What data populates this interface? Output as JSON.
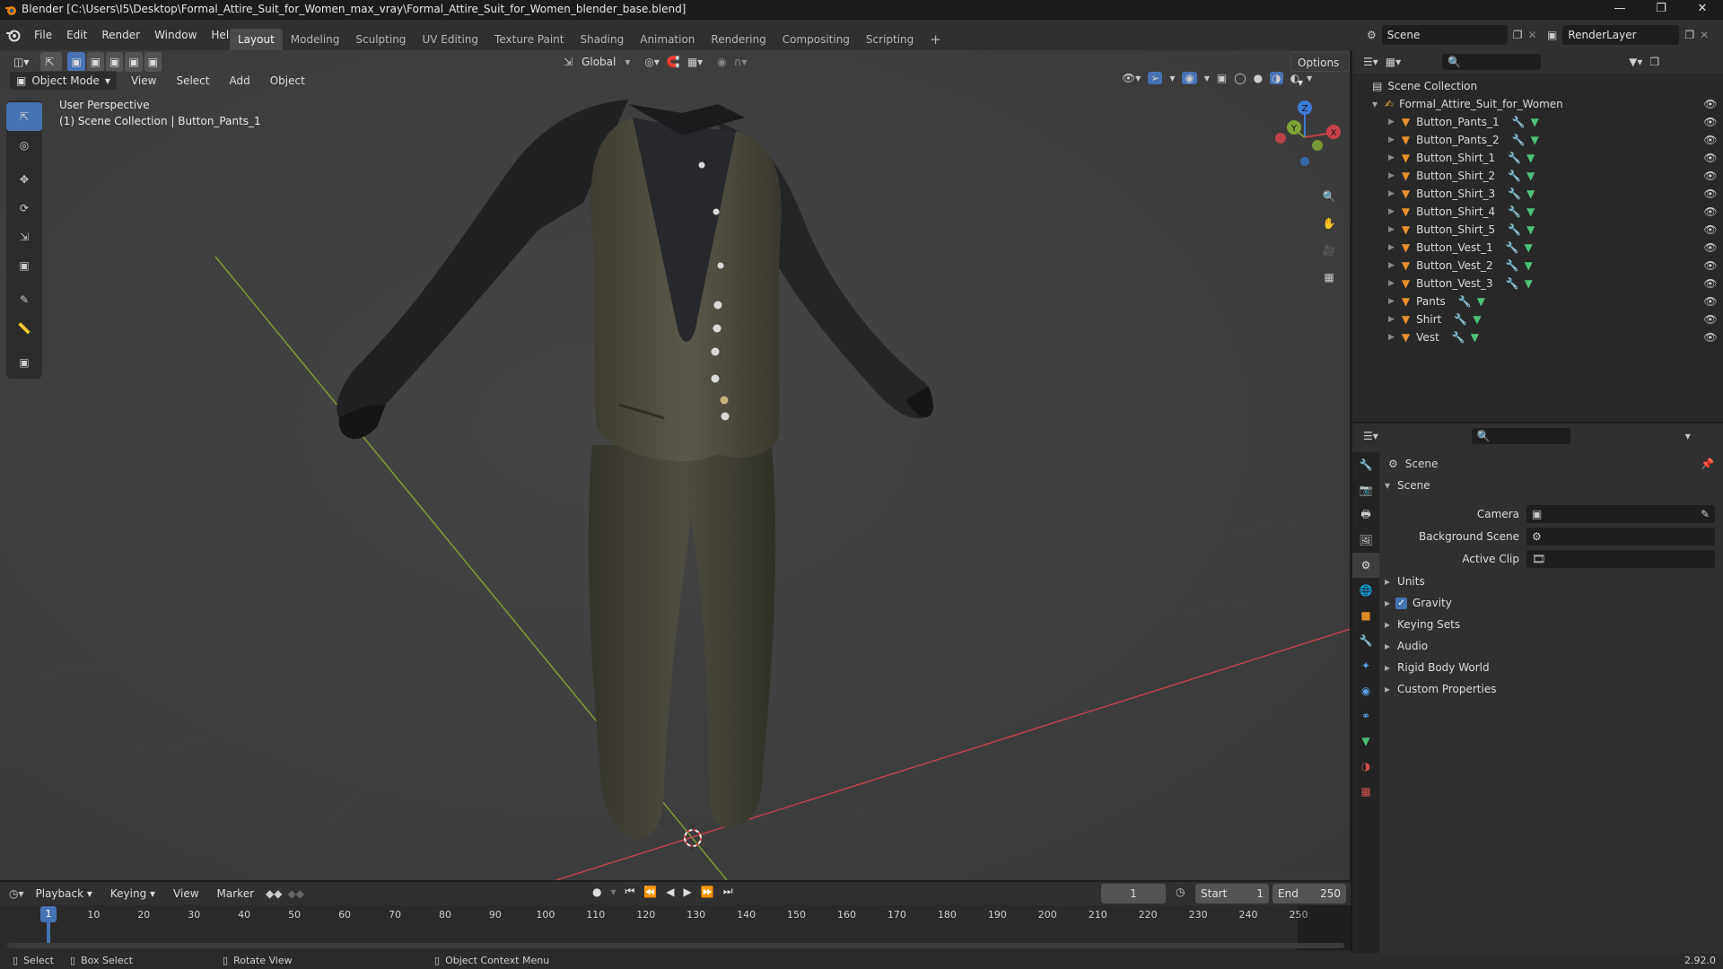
{
  "window": {
    "title": "Blender [C:\\Users\\I5\\Desktop\\Formal_Attire_Suit_for_Women_max_vray\\Formal_Attire_Suit_for_Women_blender_base.blend]",
    "controls": [
      "minimize-icon",
      "maximize-icon",
      "close-icon"
    ]
  },
  "menubar": {
    "menus": [
      "File",
      "Edit",
      "Render",
      "Window",
      "Help"
    ],
    "workspaces": [
      "Layout",
      "Modeling",
      "Sculpting",
      "UV Editing",
      "Texture Paint",
      "Shading",
      "Animation",
      "Rendering",
      "Compositing",
      "Scripting"
    ],
    "active_workspace": "Layout",
    "add_workspace": "+",
    "scene_label": "Scene",
    "renderlayer_label": "RenderLayer"
  },
  "tool_header": {
    "orientation": "Global",
    "options": "Options"
  },
  "viewport": {
    "mode": "Object Mode",
    "menus": [
      "View",
      "Select",
      "Add",
      "Object"
    ],
    "overlay_line1": "User Perspective",
    "overlay_line2": "(1) Scene Collection | Button_Pants_1",
    "gizmo": {
      "x": "X",
      "y": "Y",
      "z": "Z"
    },
    "tools": [
      "select-box-icon",
      "cursor-icon",
      "move-icon",
      "rotate-icon",
      "scale-icon",
      "transform-icon",
      "annotate-icon",
      "measure-icon",
      "add-cube-icon"
    ],
    "nav_buttons": [
      "zoom-icon",
      "pan-hand-icon",
      "camera-view-icon",
      "ortho-grid-icon"
    ],
    "colors": {
      "background": "#3d3d3d",
      "x_axis": "#c8424a",
      "y_axis": "#7ea335",
      "z_axis": "#3c7bd8"
    }
  },
  "outliner": {
    "root": "Scene Collection",
    "collection": "Formal_Attire_Suit_for_Women",
    "objects": [
      "Button_Pants_1",
      "Button_Pants_2",
      "Button_Shirt_1",
      "Button_Shirt_2",
      "Button_Shirt_3",
      "Button_Shirt_4",
      "Button_Shirt_5",
      "Button_Vest_1",
      "Button_Vest_2",
      "Button_Vest_3",
      "Pants",
      "Shirt",
      "Vest"
    ]
  },
  "properties": {
    "context": "Scene",
    "panel": "Scene",
    "fields": [
      {
        "label": "Camera",
        "value": ""
      },
      {
        "label": "Background Scene",
        "value": ""
      },
      {
        "label": "Active Clip",
        "value": ""
      }
    ],
    "subpanels": [
      "Units",
      "Gravity",
      "Keying Sets",
      "Audio",
      "Rigid Body World",
      "Custom Properties"
    ],
    "gravity_checked": true
  },
  "timeline": {
    "menus": [
      "Playback",
      "Keying",
      "View",
      "Marker"
    ],
    "current_frame": "1",
    "start_label": "Start",
    "start": "1",
    "end_label": "End",
    "end": "250",
    "ticks": [
      "1",
      "10",
      "20",
      "30",
      "40",
      "50",
      "60",
      "70",
      "80",
      "90",
      "100",
      "110",
      "120",
      "130",
      "140",
      "150",
      "160",
      "170",
      "180",
      "190",
      "200",
      "210",
      "220",
      "230",
      "240",
      "250"
    ]
  },
  "statusbar": {
    "select": "Select",
    "box_select": "Box Select",
    "rotate_view": "Rotate View",
    "context_menu": "Object Context Menu",
    "version": "2.92.0"
  }
}
